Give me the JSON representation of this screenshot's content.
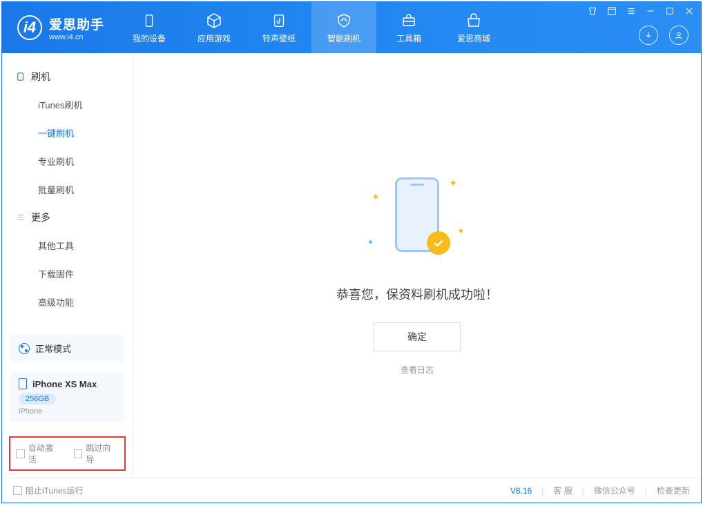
{
  "app": {
    "title": "爱思助手",
    "subtitle": "www.i4.cn"
  },
  "tabs": [
    {
      "label": "我的设备"
    },
    {
      "label": "应用游戏"
    },
    {
      "label": "铃声壁纸"
    },
    {
      "label": "智能刷机"
    },
    {
      "label": "工具箱"
    },
    {
      "label": "爱思商城"
    }
  ],
  "sidebar": {
    "group1": "刷机",
    "items1": [
      "iTunes刷机",
      "一键刷机",
      "专业刷机",
      "批量刷机"
    ],
    "group2": "更多",
    "items2": [
      "其他工具",
      "下载固件",
      "高级功能"
    ]
  },
  "mode": {
    "label": "正常模式"
  },
  "device": {
    "name": "iPhone XS Max",
    "storage": "256GB",
    "type": "iPhone"
  },
  "options": {
    "auto_activate": "自动激活",
    "skip_guide": "跳过向导"
  },
  "main": {
    "success": "恭喜您，保资料刷机成功啦！",
    "ok": "确定",
    "view_log": "查看日志"
  },
  "footer": {
    "block_itunes": "阻止iTunes运行",
    "version": "V8.16",
    "support": "客 服",
    "wechat": "微信公众号",
    "update": "检查更新"
  }
}
